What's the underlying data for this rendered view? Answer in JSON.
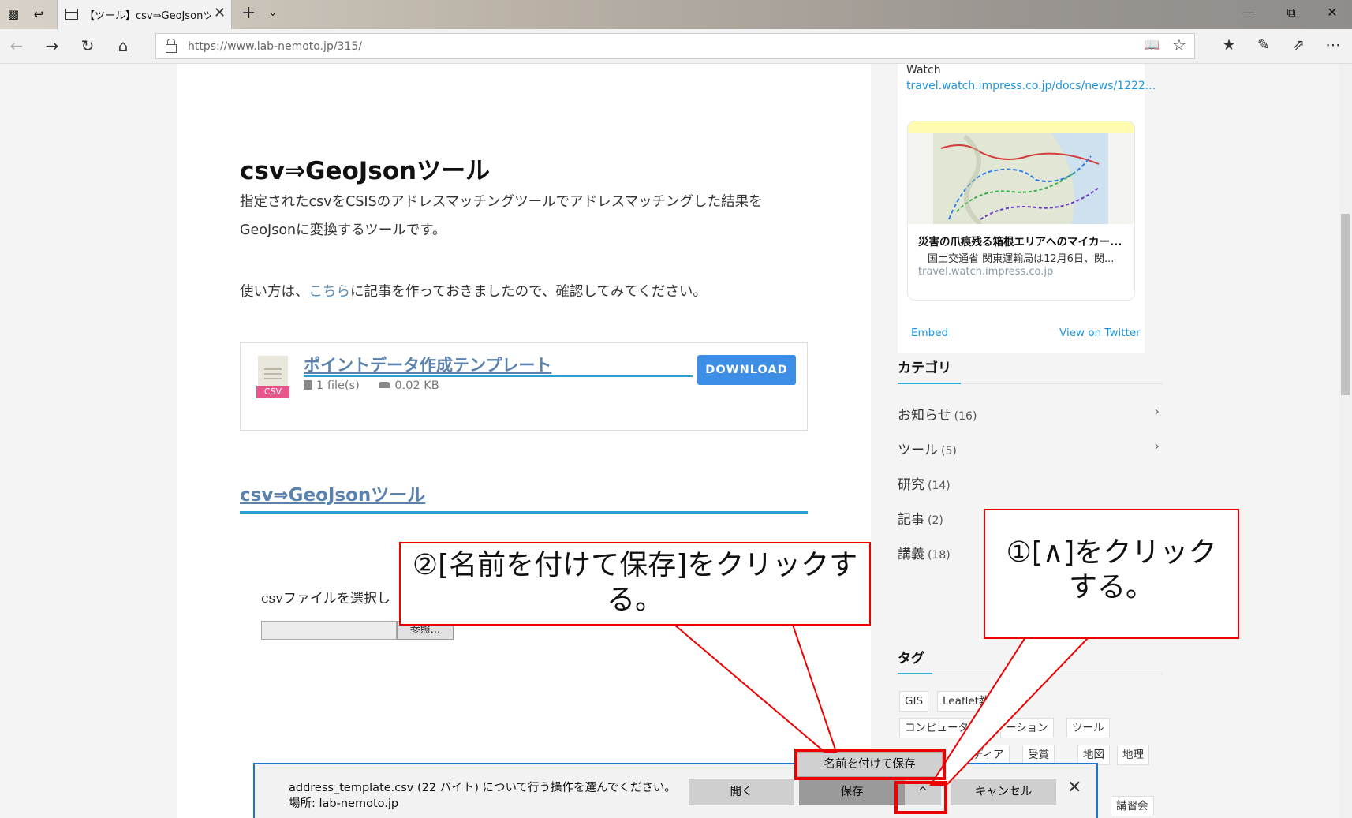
{
  "browser": {
    "tab_title": "【ツール】csv⇒GeoJsonツ-",
    "url_host": "https://www.lab-nemoto.jp",
    "url_path": "/315/"
  },
  "article": {
    "title": "csv⇒GeoJsonツール",
    "desc_line1": "指定されたcsvをCSISのアドレスマッチングツールでアドレスマッチングした結果を",
    "desc_line2": "GeoJsonに変換するツールです。",
    "usage_before": "使い方は、",
    "usage_link": "こちら",
    "usage_after": "に記事を作っておきましたので、確認してみてください。",
    "download": {
      "file_type": "CSV",
      "title": "ポイントデータ作成テンプレート",
      "files": "1 file(s)",
      "size": "0.02 KB",
      "button": "DOWNLOAD"
    },
    "section_title": "csv⇒GeoJsonツール",
    "file_label": "csvファイルを選択し",
    "browse_button": "参照..."
  },
  "sidebar": {
    "twitter": {
      "source": "Watch",
      "link": "travel.watch.impress.co.jp/docs/news/1222...",
      "card_title": "災害の爪痕残る箱根エリアへのマイカー...",
      "card_sub": "国土交通省 関東運輸局は12月6日、関...",
      "card_domain": "travel.watch.impress.co.jp",
      "embed": "Embed",
      "view_on_twitter": "View on Twitter"
    },
    "categories_heading": "カテゴリ",
    "categories": [
      {
        "name": "お知らせ",
        "count": "(16)"
      },
      {
        "name": "ツール",
        "count": "(5)"
      },
      {
        "name": "研究",
        "count": "(14)"
      },
      {
        "name": "記事",
        "count": "(2)"
      },
      {
        "name": "講義",
        "count": "(18)"
      }
    ],
    "tags_heading": "タグ",
    "tags": [
      "GIS",
      "Leaflet教材",
      "コンピュータシ",
      "ーション",
      "ツール",
      "ディア",
      "受賞",
      "地図",
      "地理",
      "講習会"
    ]
  },
  "download_bar": {
    "message": "address_template.csv (22 バイト) について行う操作を選んでください。",
    "location": "場所: lab-nemoto.jp",
    "open": "開く",
    "save": "保存",
    "chevron": "^",
    "cancel": "キャンセル",
    "save_as": "名前を付けて保存"
  },
  "annotations": {
    "callout1": "①[∧]をクリックする。",
    "callout2": "②[名前を付けて保存]をクリックする。"
  },
  "colors": {
    "accent": "#2a9fd6",
    "download_button": "#3c8ee6",
    "annotation_red": "#e00000",
    "link": "#5b82ad"
  }
}
